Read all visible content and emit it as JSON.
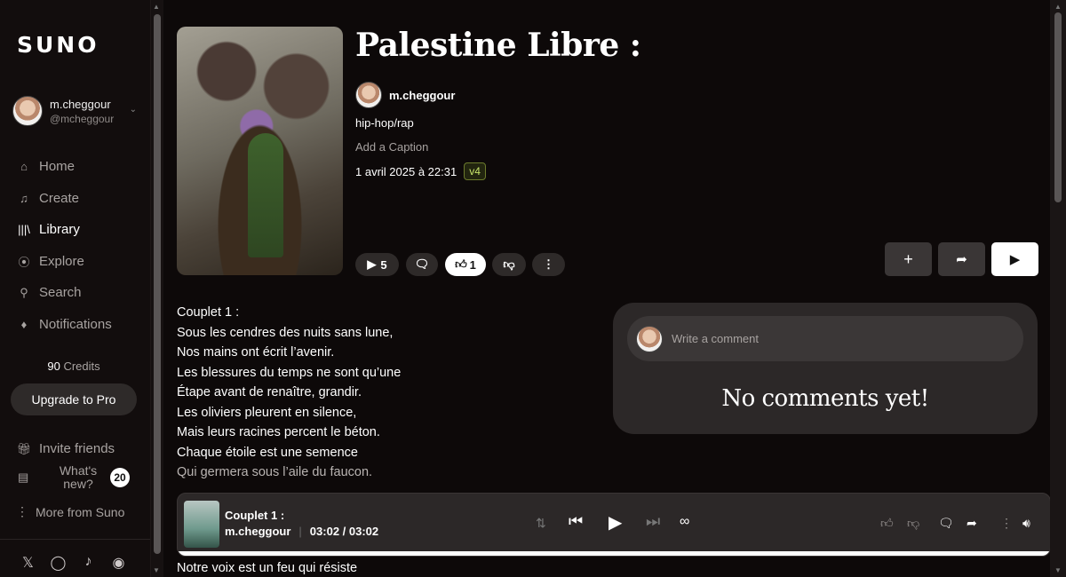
{
  "sidebar": {
    "logo": "SUNO",
    "profile": {
      "name": "m.cheggour",
      "handle": "@mcheggour"
    },
    "nav": [
      {
        "label": "Home",
        "icon": "home-icon"
      },
      {
        "label": "Create",
        "icon": "music-note-icon"
      },
      {
        "label": "Library",
        "icon": "library-icon"
      },
      {
        "label": "Explore",
        "icon": "compass-icon"
      },
      {
        "label": "Search",
        "icon": "search-icon"
      },
      {
        "label": "Notifications",
        "icon": "bell-icon"
      }
    ],
    "credits_value": "90",
    "credits_label": "Credits",
    "upgrade_label": "Upgrade to Pro",
    "invite_label": "Invite friends",
    "whats_new_label": "What's new?",
    "whats_new_count": "20",
    "more_label": "More from Suno",
    "socials": [
      "x-icon",
      "instagram-icon",
      "tiktok-icon",
      "discord-icon"
    ]
  },
  "song": {
    "title": "Palestine Libre :",
    "artist": "m.cheggour",
    "genre": "hip-hop/rap",
    "caption_placeholder": "Add a Caption",
    "date": "1 avril 2025 à 22:31",
    "version": "v4",
    "play_count": "5",
    "like_count": "1"
  },
  "lyrics": [
    "Couplet 1 :",
    "Sous les cendres des nuits sans lune,",
    "Nos mains ont écrit l’avenir.",
    "Les blessures du temps ne sont qu’une",
    "Étape avant de renaître, grandir.",
    "Les oliviers pleurent en silence,",
    "Mais leurs racines percent le béton.",
    "Chaque étoile est une semence",
    "Qui germera sous l’aile du faucon."
  ],
  "lyrics_after_player": "Notre voix est un feu qui résiste",
  "comments": {
    "placeholder": "Write a comment",
    "empty_text": "No comments yet!"
  },
  "player": {
    "song": "Couplet 1 :",
    "artist": "m.cheggour",
    "time": "03:02 / 03:02",
    "progress": 1.0
  }
}
